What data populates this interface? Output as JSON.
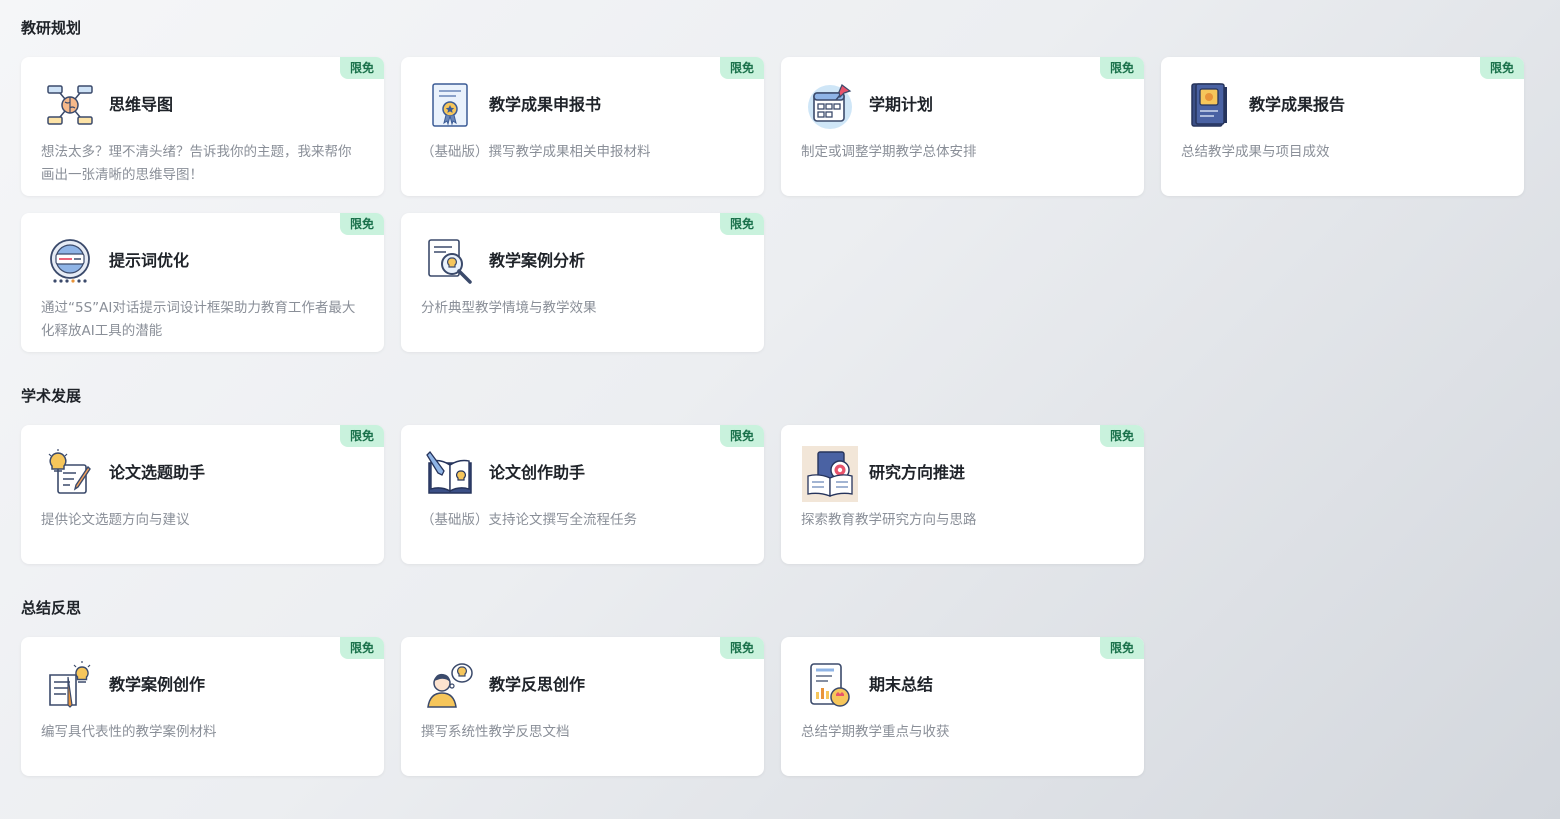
{
  "sections": [
    {
      "title": "教研规划",
      "cards": [
        {
          "title": "思维导图",
          "desc": "想法太多？理不清头绪？告诉我你的主题，我来帮你画出一张清晰的思维导图！",
          "badge": "限免",
          "icon": "mind-map-icon"
        },
        {
          "title": "教学成果申报书",
          "desc": "（基础版）撰写教学成果相关申报材料",
          "badge": "限免",
          "icon": "certificate-icon"
        },
        {
          "title": "学期计划",
          "desc": "制定或调整学期教学总体安排",
          "badge": "限免",
          "icon": "calendar-icon"
        },
        {
          "title": "教学成果报告",
          "desc": "总结教学成果与项目成效",
          "badge": "限免",
          "icon": "report-book-icon"
        },
        {
          "title": "提示词优化",
          "desc": "通过“5S”AI对话提示词设计框架助力教育工作者最大化释放AI工具的潜能",
          "badge": "限免",
          "icon": "prompt-optimize-icon"
        },
        {
          "title": "教学案例分析",
          "desc": "分析典型教学情境与教学效果",
          "badge": "限免",
          "icon": "case-analysis-icon"
        }
      ]
    },
    {
      "title": "学术发展",
      "cards": [
        {
          "title": "论文选题助手",
          "desc": "提供论文选题方向与建议",
          "badge": "限免",
          "icon": "idea-write-icon"
        },
        {
          "title": "论文创作助手",
          "desc": "（基础版）支持论文撰写全流程任务",
          "badge": "限免",
          "icon": "book-pen-icon"
        },
        {
          "title": "研究方向推进",
          "desc": "探索教育教学研究方向与思路",
          "badge": "限免",
          "icon": "research-target-icon"
        }
      ]
    },
    {
      "title": "总结反思",
      "cards": [
        {
          "title": "教学案例创作",
          "desc": "编写具代表性的教学案例材料",
          "badge": "限免",
          "icon": "document-idea-icon"
        },
        {
          "title": "教学反思创作",
          "desc": "撰写系统性教学反思文档",
          "badge": "限免",
          "icon": "person-think-icon"
        },
        {
          "title": "期末总结",
          "desc": "总结学期教学重点与收获",
          "badge": "限免",
          "icon": "summary-chart-icon"
        }
      ]
    }
  ],
  "colors": {
    "badge_bg": "#c9f2dd",
    "badge_text": "#19704a",
    "title": "#1f2329",
    "desc": "#8a8f98"
  }
}
